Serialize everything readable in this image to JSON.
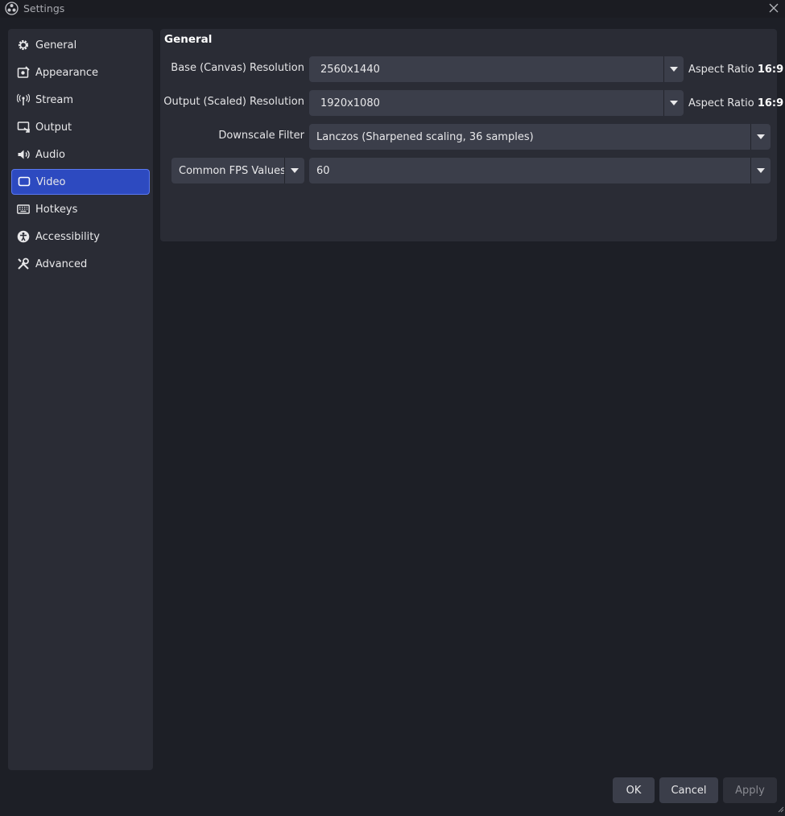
{
  "window": {
    "title": "Settings",
    "logo_icon": "obs-logo-icon",
    "close_icon": "close-icon"
  },
  "sidebar": {
    "items": [
      {
        "label": "General",
        "icon": "gear-icon"
      },
      {
        "label": "Appearance",
        "icon": "appearance-icon"
      },
      {
        "label": "Stream",
        "icon": "antenna-icon"
      },
      {
        "label": "Output",
        "icon": "output-icon"
      },
      {
        "label": "Audio",
        "icon": "speaker-icon"
      },
      {
        "label": "Video",
        "icon": "monitor-icon"
      },
      {
        "label": "Hotkeys",
        "icon": "keyboard-icon"
      },
      {
        "label": "Accessibility",
        "icon": "accessibility-icon"
      },
      {
        "label": "Advanced",
        "icon": "tools-icon"
      }
    ],
    "active_item": "Video"
  },
  "video": {
    "section_title": "General",
    "base_resolution": {
      "label": "Base (Canvas) Resolution",
      "value": "2560x1440",
      "aspect_label": "Aspect Ratio",
      "aspect_value": "16:9"
    },
    "output_resolution": {
      "label": "Output (Scaled) Resolution",
      "value": "1920x1080",
      "aspect_label": "Aspect Ratio",
      "aspect_value": "16:9"
    },
    "downscale_filter": {
      "label": "Downscale Filter",
      "value": "Lanczos (Sharpened scaling, 36 samples)"
    },
    "fps": {
      "type_value": "Common FPS Values",
      "value": "60"
    }
  },
  "buttons": {
    "ok": "OK",
    "cancel": "Cancel",
    "apply": "Apply"
  },
  "colors": {
    "accent": "#2d4ac0",
    "window_bg": "#1d1f26",
    "panel_bg": "#2a2c35",
    "control_bg": "#3b3e4a"
  }
}
